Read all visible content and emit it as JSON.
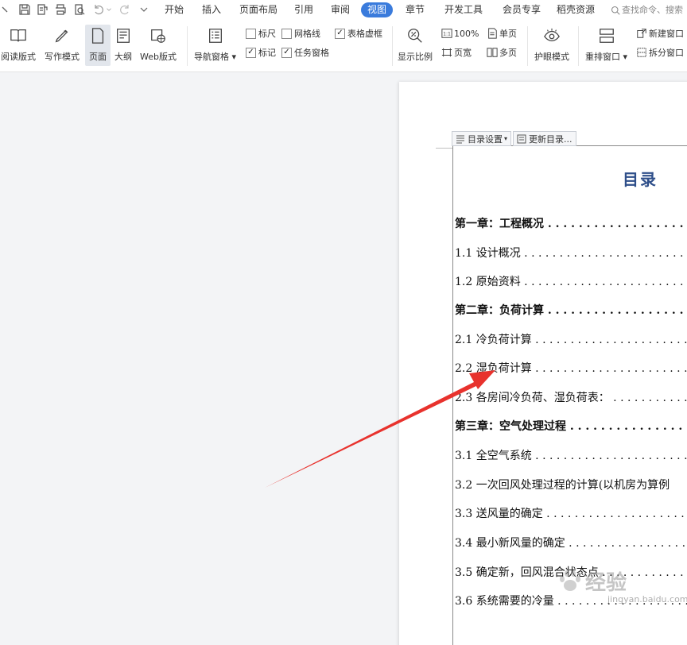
{
  "menubar": {
    "tabs": [
      "开始",
      "插入",
      "页面布局",
      "引用",
      "审阅",
      "视图",
      "章节",
      "开发工具",
      "会员专享",
      "稻壳资源"
    ],
    "active_tab": "视图",
    "search_text": "查找命令、搜索"
  },
  "ribbon": {
    "view_modes": [
      "阅读版式",
      "写作模式",
      "页面",
      "大纲",
      "Web版式"
    ],
    "active_view_mode": "页面",
    "nav_pane": "导航窗格",
    "checkboxes": [
      {
        "label": "标尺",
        "checked": false
      },
      {
        "label": "网格线",
        "checked": false
      },
      {
        "label": "表格虚框",
        "checked": true
      },
      {
        "label": "标记",
        "checked": true
      },
      {
        "label": "任务窗格",
        "checked": true
      }
    ],
    "zoom_label": "显示比例",
    "zoom_100": "100%",
    "single_page": "单页",
    "page_width": "页宽",
    "multi_page": "多页",
    "eye_mode": "护眼模式",
    "rearrange": "重排窗口",
    "new_window": "新建窗口",
    "split_window": "拆分窗口"
  },
  "document": {
    "toc_settings": "目录设置",
    "update_toc": "更新目录...",
    "toc_title": "目录",
    "entries": [
      {
        "text": "第一章：工程概况 . . . . . . . . . . . . . . . . . . . . . . . . . . .",
        "chapter": true
      },
      {
        "text": "1.1 设计概况 . . . . . . . . . . . . . . . . . . . . . . . . . . . . . .",
        "chapter": false
      },
      {
        "text": "1.2 原始资料 . . . . . . . . . . . . . . . . . . . . . . . . . . . . . .",
        "chapter": false
      },
      {
        "text": "第二章：负荷计算 . . . . . . . . . . . . . . . . . . . . . . . . . . .",
        "chapter": true
      },
      {
        "text": "2.1 冷负荷计算 . . . . . . . . . . . . . . . . . . . . . . . . . . . . .",
        "chapter": false
      },
      {
        "text": "2.2 湿负荷计算 . . . . . . . . . . . . . . . . . . . . . . . . . . . . .",
        "chapter": false
      },
      {
        "text": "2.3 各房间冷负荷、湿负荷表： . . . . . . . . . . . . . . . . . .",
        "chapter": false
      },
      {
        "text": "第三章：空气处理过程 . . . . . . . . . . . . . . . . . . . . . . . .",
        "chapter": true
      },
      {
        "text": "3.1 全空气系统 . . . . . . . . . . . . . . . . . . . . . . . . . . . . .",
        "chapter": false
      },
      {
        "text": "3.2 一次回风处理过程的计算(以机房为算例",
        "chapter": false
      },
      {
        "text": "3.3 送风量的确定 . . . . . . . . . . . . . . . . . . . . . . . . . . . .",
        "chapter": false
      },
      {
        "text": "3.4 最小新风量的确定 . . . . . . . . . . . . . . . . . . . . . . . .",
        "chapter": false
      },
      {
        "text": "3.5 确定新，回风混合状态点 . . . . . . . . . . . . . . . . . . . .",
        "chapter": false
      },
      {
        "text": "3.6 系统需要的冷量 . . . . . . . . . . . . . . . . . . . . . . . . . .",
        "chapter": false
      }
    ]
  },
  "watermark": {
    "brand": "经验",
    "url": "jingyan.baidu.com"
  },
  "colors": {
    "accent": "#3a7bdc",
    "toc_title": "#2f4f8a",
    "arrow": "#e8322d"
  }
}
